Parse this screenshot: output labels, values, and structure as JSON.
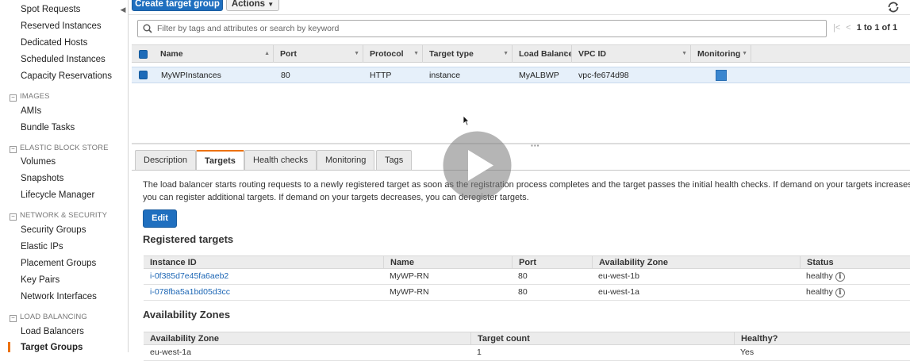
{
  "sidebar": {
    "items": [
      {
        "label": "Spot Requests"
      },
      {
        "label": "Reserved Instances"
      },
      {
        "label": "Dedicated Hosts"
      },
      {
        "label": "Scheduled Instances"
      },
      {
        "label": "Capacity Reservations"
      }
    ],
    "images_section": "IMAGES",
    "images_items": [
      {
        "label": "AMIs"
      },
      {
        "label": "Bundle Tasks"
      }
    ],
    "ebs_section": "ELASTIC BLOCK STORE",
    "ebs_items": [
      {
        "label": "Volumes"
      },
      {
        "label": "Snapshots"
      },
      {
        "label": "Lifecycle Manager"
      }
    ],
    "network_section": "NETWORK & SECURITY",
    "network_items": [
      {
        "label": "Security Groups"
      },
      {
        "label": "Elastic IPs"
      },
      {
        "label": "Placement Groups"
      },
      {
        "label": "Key Pairs"
      },
      {
        "label": "Network Interfaces"
      }
    ],
    "lb_section": "LOAD BALANCING",
    "lb_items": [
      {
        "label": "Load Balancers"
      },
      {
        "label": "Target Groups"
      }
    ],
    "active_item": "Target Groups"
  },
  "toolbar": {
    "create_label": "Create target group",
    "actions_label": "Actions",
    "refresh_icon": "refresh-icon"
  },
  "filter": {
    "placeholder": "Filter by tags and attributes or search by keyword",
    "pager_text": "1 to 1 of 1"
  },
  "grid": {
    "columns": [
      "Name",
      "Port",
      "Protocol",
      "Target type",
      "Load Balancer",
      "VPC ID",
      "Monitoring"
    ],
    "rows": [
      {
        "name": "MyWPInstances",
        "port": "80",
        "protocol": "HTTP",
        "target_type": "instance",
        "load_balancer": "MyALBWP",
        "vpc_id": "vpc-fe674d98",
        "monitoring": "enabled"
      }
    ]
  },
  "tabs": [
    {
      "label": "Description"
    },
    {
      "label": "Targets",
      "active": true
    },
    {
      "label": "Health checks"
    },
    {
      "label": "Monitoring"
    },
    {
      "label": "Tags"
    }
  ],
  "targets": {
    "description": "The load balancer starts routing requests to a newly registered target as soon as the registration process completes and the target passes the initial health checks. If demand on your targets increases, you can register additional targets. If demand on your targets decreases, you can deregister targets.",
    "edit_label": "Edit",
    "registered_title": "Registered targets",
    "registered_columns": [
      "Instance ID",
      "Name",
      "Port",
      "Availability Zone",
      "Status"
    ],
    "registered_rows": [
      {
        "instance_id": "i-0f385d7e45fa6aeb2",
        "name": "MyWP-RN",
        "port": "80",
        "zone": "eu-west-1b",
        "status": "healthy"
      },
      {
        "instance_id": "i-078fba5a1bd05d3cc",
        "name": "MyWP-RN",
        "port": "80",
        "zone": "eu-west-1a",
        "status": "healthy"
      }
    ],
    "az_title": "Availability Zones",
    "az_columns": [
      "Availability Zone",
      "Target count",
      "Healthy?"
    ],
    "az_rows": [
      {
        "zone": "eu-west-1a",
        "count": "1",
        "healthy": "Yes"
      }
    ]
  },
  "colors": {
    "accent": "#ec7211",
    "primary": "#1f6fbf",
    "link": "#1c66b5"
  }
}
